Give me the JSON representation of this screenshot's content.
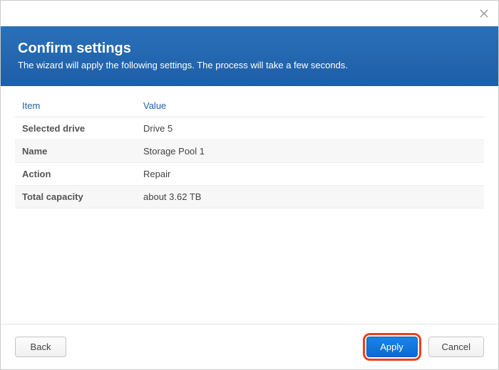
{
  "header": {
    "title": "Confirm settings",
    "subtitle": "The wizard will apply the following settings. The process will take a few seconds."
  },
  "table": {
    "col_item": "Item",
    "col_value": "Value",
    "rows": [
      {
        "item": "Selected drive",
        "value": "Drive 5"
      },
      {
        "item": "Name",
        "value": "Storage Pool 1"
      },
      {
        "item": "Action",
        "value": "Repair"
      },
      {
        "item": "Total capacity",
        "value": "about 3.62 TB"
      }
    ]
  },
  "footer": {
    "back": "Back",
    "apply": "Apply",
    "cancel": "Cancel"
  }
}
